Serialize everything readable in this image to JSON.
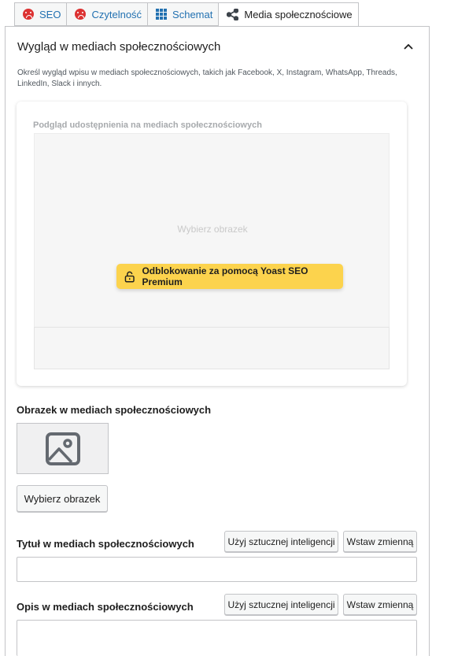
{
  "tabs": [
    {
      "label": "SEO",
      "icon": "sad-face-icon"
    },
    {
      "label": "Czytelność",
      "icon": "sad-face-icon"
    },
    {
      "label": "Schemat",
      "icon": "grid-icon"
    },
    {
      "label": "Media społecznościowe",
      "icon": "share-icon"
    }
  ],
  "section": {
    "title": "Wygląd w mediach społecznościowych",
    "description": "Określ wygląd wpisu w mediach społecznościowych, takich jak Facebook, X, Instagram, WhatsApp, Threads, LinkedIn, Slack i innych."
  },
  "preview": {
    "title": "Podgląd udostępnienia na mediach społecznościowych",
    "placeholder": "Wybierz obrazek",
    "unlock_label": "Odblokowanie za pomocą Yoast SEO Premium"
  },
  "image_field": {
    "label": "Obrazek w mediach społecznościowych",
    "button": "Wybierz obrazek"
  },
  "title_field": {
    "label": "Tytuł w mediach społecznościowych",
    "ai_button": "Użyj sztucznej inteligencji",
    "variable_button": "Wstaw zmienną",
    "value": ""
  },
  "desc_field": {
    "label": "Opis w mediach społecznościowych",
    "ai_button": "Użyj sztucznej inteligencji",
    "variable_button": "Wstaw zmienną",
    "value": ""
  },
  "colors": {
    "error_face": "#dc3232",
    "link": "#2271b1",
    "premium": "#fcd34d"
  }
}
